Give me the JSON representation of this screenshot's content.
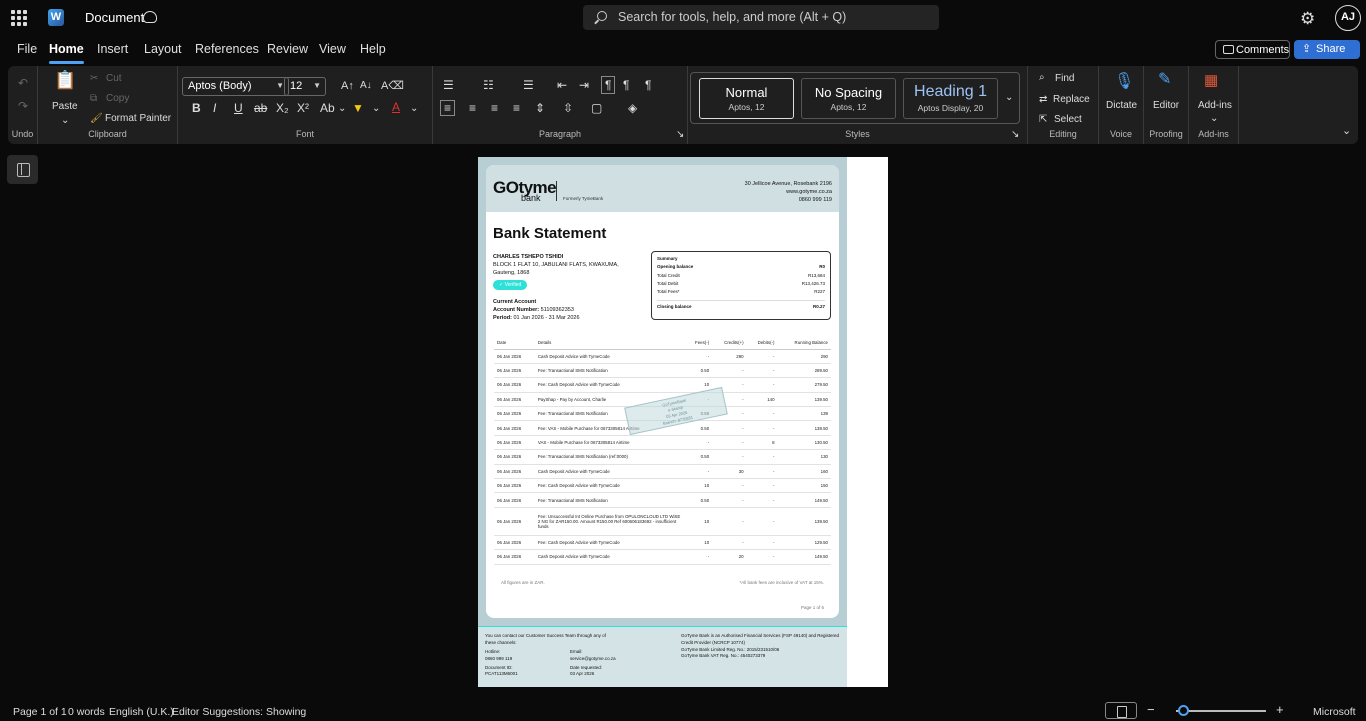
{
  "app": {
    "title": "Document",
    "search_placeholder": "Search for tools, help, and more (Alt + Q)",
    "user_initials": "AJ"
  },
  "menu": [
    "File",
    "Home",
    "Insert",
    "Layout",
    "References",
    "Review",
    "View",
    "Help"
  ],
  "actions": {
    "comments": "Comments",
    "share": "Share"
  },
  "ribbon": {
    "undo_label": "Undo",
    "clipboard": {
      "paste": "Paste",
      "cut": "Cut",
      "copy": "Copy",
      "format_painter": "Format Painter",
      "label": "Clipboard"
    },
    "font": {
      "name": "Aptos (Body)",
      "size": "12",
      "label": "Font"
    },
    "paragraph": {
      "label": "Paragraph"
    },
    "styles": {
      "label": "Styles",
      "items": [
        {
          "name": "Normal",
          "sub": "Aptos, 12"
        },
        {
          "name": "No Spacing",
          "sub": "Aptos, 12"
        },
        {
          "name": "Heading 1",
          "sub": "Aptos Display, 20"
        }
      ]
    },
    "editing": {
      "find": "Find",
      "replace": "Replace",
      "select": "Select",
      "label": "Editing"
    },
    "voice": {
      "dictate": "Dictate",
      "label": "Voice"
    },
    "proofing": {
      "editor": "Editor",
      "label": "Proofing"
    },
    "addins": {
      "addins": "Add-ins",
      "label": "Add-ins"
    }
  },
  "statement": {
    "logo": "GOtyme",
    "logo_sub": "bank",
    "formerly": "Formerly TymeBank",
    "address": [
      "30 Jellicoe Avenue, Rosebank 2196",
      "www.gotyme.co.za",
      "0860 999 119"
    ],
    "title": "Bank Statement",
    "customer_name": "CHARLES TSHEPO TSHIDI",
    "customer_address_1": "BLOCK 1 FLAT 10, JABULANI FLATS, KWAXUMA,",
    "customer_address_2": "Gauteng, 1868",
    "verified": "Verified",
    "account_type": "Current Account",
    "account_number_label": "Account Number:",
    "account_number": "51109362353",
    "period_label": "Period:",
    "period": "01 Jan 2026 - 31 Mar 2026",
    "summary": {
      "title": "Summary",
      "rows": [
        {
          "label": "Opening balance",
          "value": "R0",
          "bold": true
        },
        {
          "label": "Total Credit",
          "value": "R13,684",
          "bold": false
        },
        {
          "label": "Total Debit",
          "value": "R13,426.73",
          "bold": false
        },
        {
          "label": "Total Fees*",
          "value": "R227",
          "bold": false
        },
        {
          "label": "",
          "value": "",
          "bold": false
        },
        {
          "label": "Closing balance",
          "value": "R0.27",
          "bold": true
        }
      ]
    },
    "table": {
      "headers": [
        "Date",
        "Details",
        "Fees(-)",
        "Credits(+)",
        "Debits(-)",
        "Running Balance"
      ],
      "rows": [
        [
          "06 Jan 2026",
          "Cash Deposit Advice with TymeCode",
          "-",
          "290",
          "-",
          "290"
        ],
        [
          "06 Jan 2026",
          "Fee: Transactional SMS Notification",
          "0.50",
          "-",
          "-",
          "289.50"
        ],
        [
          "06 Jan 2026",
          "Fee: Cash Deposit Advice with TymeCode",
          "10",
          "-",
          "-",
          "279.50"
        ],
        [
          "06 Jan 2026",
          "PayShap - Pay by Account, Charlie",
          "-",
          "-",
          "140",
          "139.50"
        ],
        [
          "06 Jan 2026",
          "Fee: Transactional SMS Notification",
          "0.50",
          "-",
          "-",
          "139"
        ],
        [
          "06 Jan 2026",
          "Fee: VAS - Mobile Purchase for 0673305814 Airtime",
          "0.50",
          "-",
          "-",
          "138.50"
        ],
        [
          "06 Jan 2026",
          "VAS - Mobile Purchase for 0673305814 Airtime",
          "-",
          "-",
          "8",
          "130.50"
        ],
        [
          "06 Jan 2026",
          "Fee: Transactional SMS Notification (ref:0000)",
          "0.50",
          "-",
          "-",
          "130"
        ],
        [
          "06 Jan 2026",
          "Cash Deposit Advice with TymeCode",
          "-",
          "30",
          "-",
          "160"
        ],
        [
          "06 Jan 2026",
          "Fee: Cash Deposit Advice with TymeCode",
          "10",
          "-",
          "-",
          "150"
        ],
        [
          "06 Jan 2026",
          "Fee: Transactional SMS Notification",
          "0.50",
          "-",
          "-",
          "149.50"
        ],
        [
          "06 Jan 2026",
          "Fee: Unsuccessful Int Online Purchase from OPULONCLOUD LTD WiSE 2 NG for ZAR150.00. Amount R150.00 Ref 600606183692 - insufficient funds",
          "10",
          "-",
          "-",
          "139.50"
        ],
        [
          "06 Jan 2026",
          "Fee: Cash Deposit Advice with TymeCode",
          "10",
          "-",
          "-",
          "129.50"
        ],
        [
          "06 Jan 2026",
          "Cash Deposit Advice with TymeCode",
          "-",
          "20",
          "-",
          "149.50"
        ]
      ]
    },
    "stamp": [
      "GoTymeBank",
      "e-Stamp",
      "03 Apr 2026",
      "Branch: 8770551"
    ],
    "note_left": "All figures are in ZAR.",
    "note_right": "*All bank fees are inclusive of VAT at 15%.",
    "page": "Page 1 of 6",
    "contact": "You can contact our Customer Success Team through any of these channels:",
    "hotline_label": "Hotline:",
    "hotline": "0860 999 119",
    "email_label": "Email:",
    "email": "service@gotyme.co.za",
    "docid_label": "Document ID:",
    "docid": "PCAT113M6001",
    "date_label": "Date requested:",
    "date": "03 Apr 2026",
    "legal": [
      "GoTyme Bank is an Authorised Financial Services (FSP 49140) and Registered Credit Provider (NCRCP 10774)",
      "GoTyme Bank Limited Reg. No.: 2015/231510/06",
      "GoTyme Bank VAT Reg. No.: 4540273379"
    ]
  },
  "status": {
    "page": "Page 1 of 1",
    "words": "0 words",
    "language": "English (U.K.)",
    "editor": "Editor Suggestions: Showing",
    "brand": "Microsoft"
  }
}
